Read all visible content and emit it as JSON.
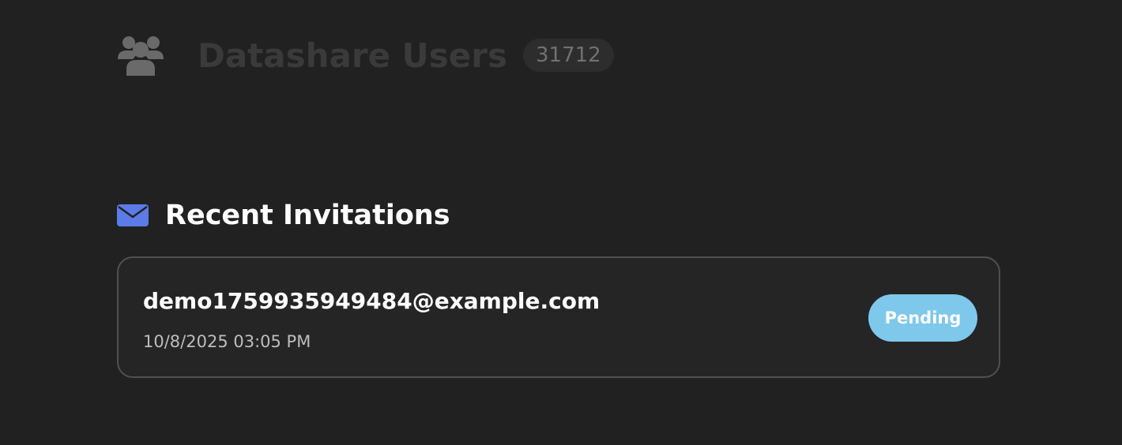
{
  "users_section": {
    "title": "Datashare Users",
    "count": "31712",
    "icon": "users-icon"
  },
  "invitations_section": {
    "title": "Recent Invitations",
    "icon": "mail-icon",
    "accent_color": "#5b7be9",
    "items": [
      {
        "email": "demo1759935949484@example.com",
        "date": "10/8/2025 03:05 PM",
        "status": "Pending",
        "status_color": "#7ec8ec"
      }
    ]
  }
}
